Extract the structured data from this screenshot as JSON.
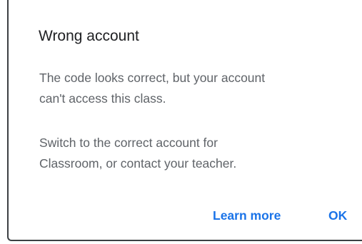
{
  "dialog": {
    "title": "Wrong account",
    "message_1": {
      "line_1": "The code looks correct, but your account",
      "line_2": "can't access this class."
    },
    "message_2": {
      "line_1": "Switch to the correct account for",
      "line_2": "Classroom, or contact your teacher."
    },
    "actions": {
      "learn_more_label": "Learn more",
      "ok_label": "OK"
    }
  },
  "colors": {
    "title": "#202124",
    "body_text": "#5f6368",
    "action_text": "#1a73e8",
    "background": "#ffffff"
  }
}
